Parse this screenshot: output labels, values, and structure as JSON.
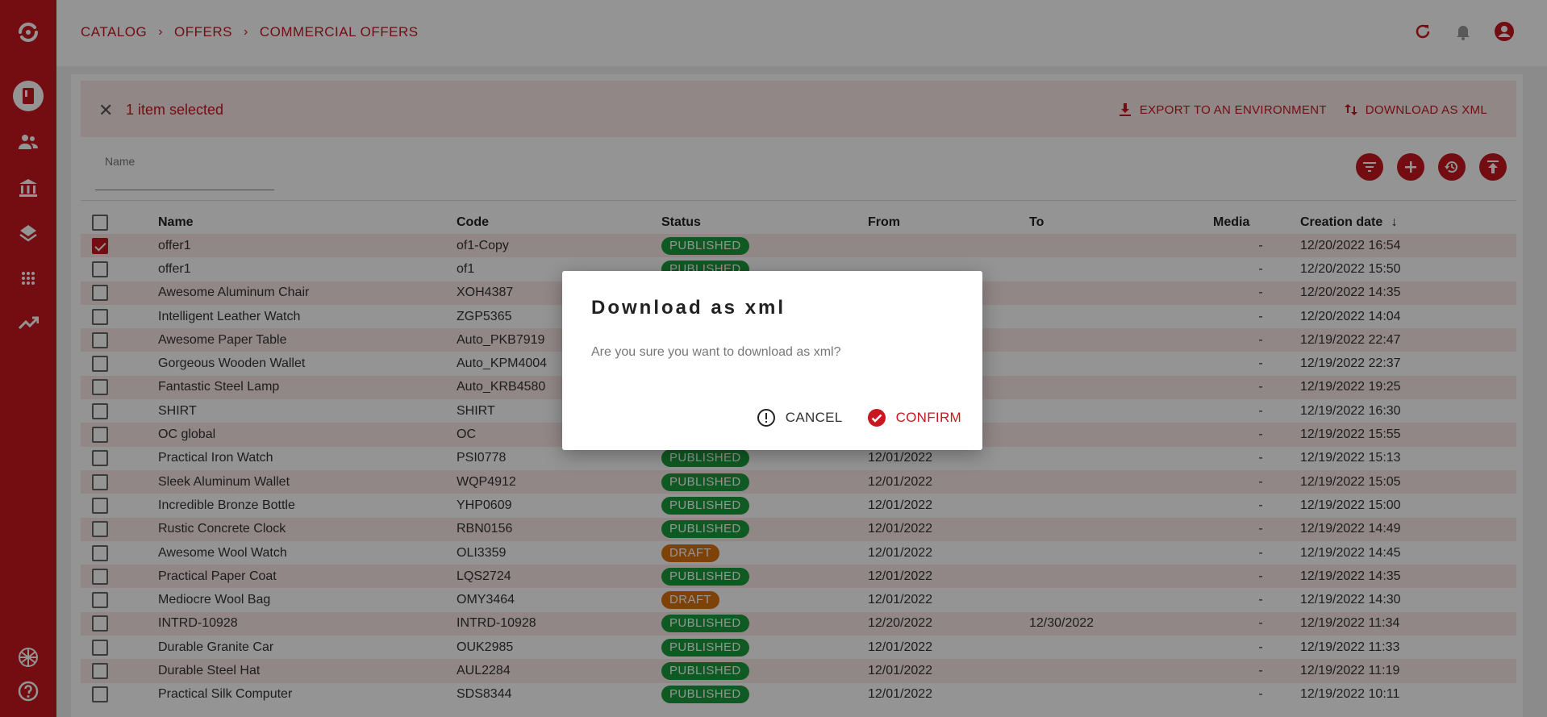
{
  "breadcrumb": [
    "CATALOG",
    "OFFERS",
    "COMMERCIAL OFFERS"
  ],
  "sidebar": {
    "items": [
      "app-logo-icon",
      "catalog-icon",
      "users-icon",
      "bank-icon",
      "layers-icon",
      "dots-grid-icon",
      "trending-icon"
    ],
    "bottom": [
      "language-flag-icon",
      "help-icon"
    ]
  },
  "topbar": {
    "icons": [
      "refresh-icon",
      "bell-icon",
      "account-icon"
    ]
  },
  "selection": {
    "text": "1 item selected",
    "actions": [
      "EXPORT TO AN ENVIRONMENT",
      "DOWNLOAD AS XML"
    ]
  },
  "filter": {
    "name_label": "Name"
  },
  "table": {
    "headers": [
      "Name",
      "Code",
      "Status",
      "From",
      "To",
      "Media",
      "Creation date"
    ],
    "rows": [
      {
        "checked": true,
        "name": "offer1",
        "code": "of1-Copy",
        "status": "PUBLISHED",
        "from": "",
        "to": "",
        "media": "-",
        "created": "12/20/2022 16:54"
      },
      {
        "checked": false,
        "name": "offer1",
        "code": "of1",
        "status": "PUBLISHED",
        "from": "",
        "to": "",
        "media": "-",
        "created": "12/20/2022 15:50"
      },
      {
        "checked": false,
        "name": "Awesome Aluminum Chair",
        "code": "XOH4387",
        "status": "",
        "from": "",
        "to": "",
        "media": "-",
        "created": "12/20/2022 14:35"
      },
      {
        "checked": false,
        "name": "Intelligent Leather Watch",
        "code": "ZGP5365",
        "status": "",
        "from": "",
        "to": "",
        "media": "-",
        "created": "12/20/2022 14:04"
      },
      {
        "checked": false,
        "name": "Awesome Paper Table",
        "code": "Auto_PKB7919",
        "status": "",
        "from": "",
        "to": "",
        "media": "-",
        "created": "12/19/2022 22:47"
      },
      {
        "checked": false,
        "name": "Gorgeous Wooden Wallet",
        "code": "Auto_KPM4004",
        "status": "",
        "from": "",
        "to": "",
        "media": "-",
        "created": "12/19/2022 22:37"
      },
      {
        "checked": false,
        "name": "Fantastic Steel Lamp",
        "code": "Auto_KRB4580",
        "status": "",
        "from": "",
        "to": "",
        "media": "-",
        "created": "12/19/2022 19:25"
      },
      {
        "checked": false,
        "name": "SHIRT",
        "code": "SHIRT",
        "status": "",
        "from": "",
        "to": "",
        "media": "-",
        "created": "12/19/2022 16:30"
      },
      {
        "checked": false,
        "name": "OC global",
        "code": "OC",
        "status": "",
        "from": "",
        "to": "",
        "media": "-",
        "created": "12/19/2022 15:55"
      },
      {
        "checked": false,
        "name": "Practical Iron Watch",
        "code": "PSI0778",
        "status": "PUBLISHED",
        "from": "12/01/2022",
        "to": "",
        "media": "-",
        "created": "12/19/2022 15:13"
      },
      {
        "checked": false,
        "name": "Sleek Aluminum Wallet",
        "code": "WQP4912",
        "status": "PUBLISHED",
        "from": "12/01/2022",
        "to": "",
        "media": "-",
        "created": "12/19/2022 15:05"
      },
      {
        "checked": false,
        "name": "Incredible Bronze Bottle",
        "code": "YHP0609",
        "status": "PUBLISHED",
        "from": "12/01/2022",
        "to": "",
        "media": "-",
        "created": "12/19/2022 15:00"
      },
      {
        "checked": false,
        "name": "Rustic Concrete Clock",
        "code": "RBN0156",
        "status": "PUBLISHED",
        "from": "12/01/2022",
        "to": "",
        "media": "-",
        "created": "12/19/2022 14:49"
      },
      {
        "checked": false,
        "name": "Awesome Wool Watch",
        "code": "OLI3359",
        "status": "DRAFT",
        "from": "12/01/2022",
        "to": "",
        "media": "-",
        "created": "12/19/2022 14:45"
      },
      {
        "checked": false,
        "name": "Practical Paper Coat",
        "code": "LQS2724",
        "status": "PUBLISHED",
        "from": "12/01/2022",
        "to": "",
        "media": "-",
        "created": "12/19/2022 14:35"
      },
      {
        "checked": false,
        "name": "Mediocre Wool Bag",
        "code": "OMY3464",
        "status": "DRAFT",
        "from": "12/01/2022",
        "to": "",
        "media": "-",
        "created": "12/19/2022 14:30"
      },
      {
        "checked": false,
        "name": "INTRD-10928",
        "code": "INTRD-10928",
        "status": "PUBLISHED",
        "from": "12/20/2022",
        "to": "12/30/2022",
        "media": "-",
        "created": "12/19/2022 11:34"
      },
      {
        "checked": false,
        "name": "Durable Granite Car",
        "code": "OUK2985",
        "status": "PUBLISHED",
        "from": "12/01/2022",
        "to": "",
        "media": "-",
        "created": "12/19/2022 11:33"
      },
      {
        "checked": false,
        "name": "Durable Steel Hat",
        "code": "AUL2284",
        "status": "PUBLISHED",
        "from": "12/01/2022",
        "to": "",
        "media": "-",
        "created": "12/19/2022 11:19"
      },
      {
        "checked": false,
        "name": "Practical Silk Computer",
        "code": "SDS8344",
        "status": "PUBLISHED",
        "from": "12/01/2022",
        "to": "",
        "media": "-",
        "created": "12/19/2022 10:11"
      }
    ]
  },
  "dialog": {
    "title": "Download as xml",
    "message": "Are you sure you want to download as xml?",
    "cancel": "CANCEL",
    "confirm": "CONFIRM"
  },
  "colors": {
    "brand": "#c8171f",
    "published": "#1a9c3b",
    "draft": "#d9730f",
    "row_alt": "#fce8e9"
  }
}
